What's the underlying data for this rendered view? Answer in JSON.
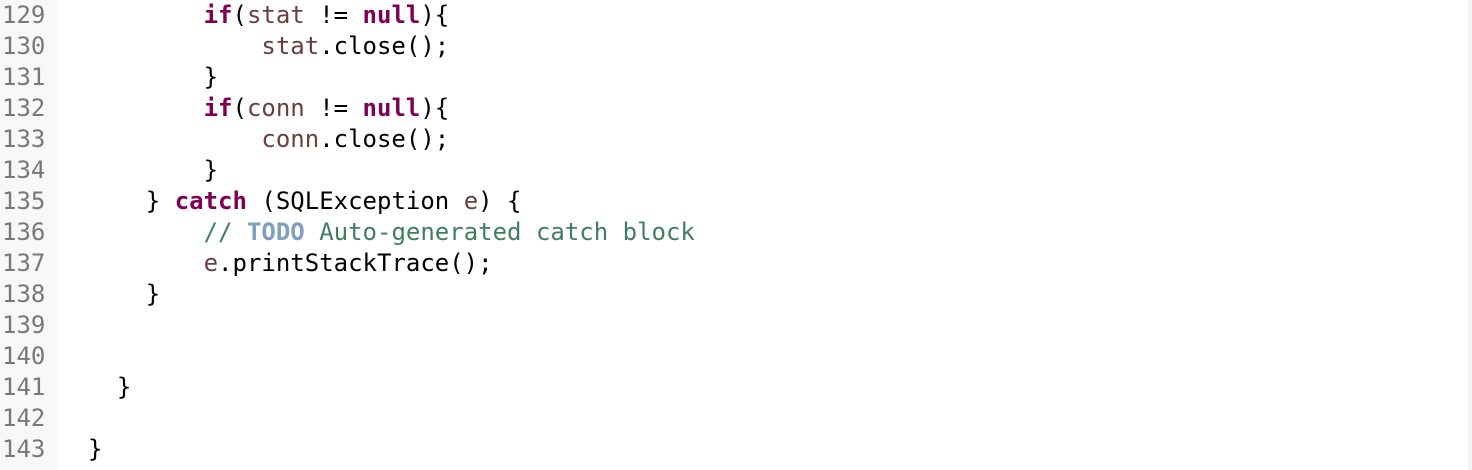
{
  "editor": {
    "lines": [
      {
        "number": "129",
        "tokens": [
          {
            "t": "        ",
            "c": "punc"
          },
          {
            "t": "if",
            "c": "kw"
          },
          {
            "t": "(",
            "c": "punc"
          },
          {
            "t": "stat",
            "c": "var"
          },
          {
            "t": " != ",
            "c": "punc"
          },
          {
            "t": "null",
            "c": "kw"
          },
          {
            "t": "){",
            "c": "punc"
          }
        ]
      },
      {
        "number": "130",
        "tokens": [
          {
            "t": "            ",
            "c": "punc"
          },
          {
            "t": "stat",
            "c": "var"
          },
          {
            "t": ".close();",
            "c": "punc"
          }
        ]
      },
      {
        "number": "131",
        "tokens": [
          {
            "t": "        }",
            "c": "punc"
          }
        ]
      },
      {
        "number": "132",
        "tokens": [
          {
            "t": "        ",
            "c": "punc"
          },
          {
            "t": "if",
            "c": "kw"
          },
          {
            "t": "(",
            "c": "punc"
          },
          {
            "t": "conn",
            "c": "var"
          },
          {
            "t": " != ",
            "c": "punc"
          },
          {
            "t": "null",
            "c": "kw"
          },
          {
            "t": "){",
            "c": "punc"
          }
        ]
      },
      {
        "number": "133",
        "tokens": [
          {
            "t": "            ",
            "c": "punc"
          },
          {
            "t": "conn",
            "c": "var"
          },
          {
            "t": ".close();",
            "c": "punc"
          }
        ]
      },
      {
        "number": "134",
        "tokens": [
          {
            "t": "        }",
            "c": "punc"
          }
        ]
      },
      {
        "number": "135",
        "tokens": [
          {
            "t": "    } ",
            "c": "punc"
          },
          {
            "t": "catch",
            "c": "kw"
          },
          {
            "t": " (SQLException ",
            "c": "punc"
          },
          {
            "t": "e",
            "c": "var"
          },
          {
            "t": ") {",
            "c": "punc"
          }
        ]
      },
      {
        "number": "136",
        "tokens": [
          {
            "t": "        ",
            "c": "punc"
          },
          {
            "t": "// ",
            "c": "cmt"
          },
          {
            "t": "TODO",
            "c": "todo"
          },
          {
            "t": " Auto-generated catch block",
            "c": "cmt"
          }
        ]
      },
      {
        "number": "137",
        "tokens": [
          {
            "t": "        ",
            "c": "punc"
          },
          {
            "t": "e",
            "c": "var"
          },
          {
            "t": ".printStackTrace();",
            "c": "punc"
          }
        ]
      },
      {
        "number": "138",
        "tokens": [
          {
            "t": "    }",
            "c": "punc"
          }
        ]
      },
      {
        "number": "139",
        "tokens": []
      },
      {
        "number": "140",
        "tokens": []
      },
      {
        "number": "141",
        "tokens": [
          {
            "t": "  }",
            "c": "punc"
          }
        ]
      },
      {
        "number": "142",
        "tokens": []
      },
      {
        "number": "143",
        "tokens": [
          {
            "t": "}",
            "c": "punc"
          }
        ]
      }
    ]
  },
  "colors": {
    "keyword": "#7f0055",
    "variable": "#6a3e3e",
    "comment": "#3f7f5f",
    "todo": "#7f9fbf",
    "line_number": "#787878",
    "gutter_background": "#f8f8f8"
  }
}
